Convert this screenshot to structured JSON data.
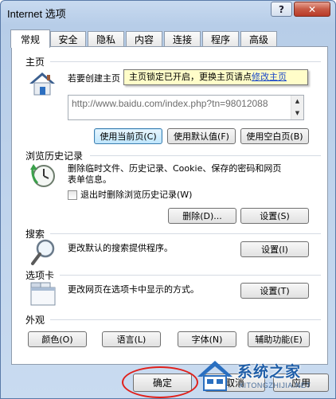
{
  "window": {
    "title": "Internet 选项",
    "help_label": "?",
    "close_label": "✕"
  },
  "tabs": [
    {
      "label": "常规",
      "active": true
    },
    {
      "label": "安全"
    },
    {
      "label": "隐私"
    },
    {
      "label": "内容"
    },
    {
      "label": "连接"
    },
    {
      "label": "程序"
    },
    {
      "label": "高级"
    }
  ],
  "homepage": {
    "title": "主页",
    "description": "若要创建主页",
    "url": "http://www.baidu.com/index.php?tn=98012088",
    "tooltip_text": "主页锁定已开启，更换主页请点",
    "tooltip_link": "修改主页",
    "buttons": {
      "use_current": "使用当前页(C)",
      "use_default": "使用默认值(F)",
      "use_blank": "使用空白页(B)"
    }
  },
  "history": {
    "title": "浏览历史记录",
    "description_line1": "删除临时文件、历史记录、Cookie、保存的密码和网页",
    "description_line2": "表单信息。",
    "checkbox_label": "退出时删除浏览历史记录(W)",
    "checkbox_checked": false,
    "delete_button": "删除(D)...",
    "settings_button": "设置(S)"
  },
  "search": {
    "title": "搜索",
    "description": "更改默认的搜索提供程序。",
    "settings_button": "设置(I)"
  },
  "tabs_section": {
    "title": "选项卡",
    "description": "更改网页在选项卡中显示的方式。",
    "settings_button": "设置(T)"
  },
  "appearance": {
    "title": "外观",
    "buttons": {
      "colors": "颜色(O)",
      "languages": "语言(L)",
      "fonts": "字体(N)",
      "accessibility": "辅助功能(E)"
    }
  },
  "footer": {
    "ok": "确定",
    "cancel": "取消",
    "apply": "应用"
  },
  "watermark": {
    "title": "系统之家",
    "subtitle": "XITONGZHIJIA.NET"
  },
  "colors": {
    "accent": "#3c7fb1",
    "tooltip_bg": "#fffdc9",
    "highlight_circle": "#e0201b"
  }
}
